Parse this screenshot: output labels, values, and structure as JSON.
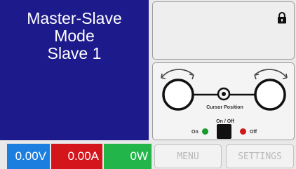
{
  "mode": {
    "line1": "Master-Slave",
    "line2": "Mode",
    "line3": "Slave 1"
  },
  "control_panel": {
    "cursor_position_label": "Cursor Position",
    "on_off_label": "On / Off",
    "on_label": "On",
    "off_label": "Off"
  },
  "readouts": {
    "voltage": "0.00V",
    "current": "0.00A",
    "power": "0W"
  },
  "buttons": {
    "menu": "MENU",
    "settings": "SETTINGS"
  },
  "colors": {
    "panel_blue": "#1d1a8c",
    "voltage_blue": "#1c7fe0",
    "current_red": "#d4151b",
    "power_green": "#22b54a",
    "led_on": "#1a9a2a",
    "led_off": "#d01818"
  },
  "icons": {
    "lock": "lock-icon",
    "knob": "rotary-knob-icon",
    "power": "power-button-icon"
  }
}
